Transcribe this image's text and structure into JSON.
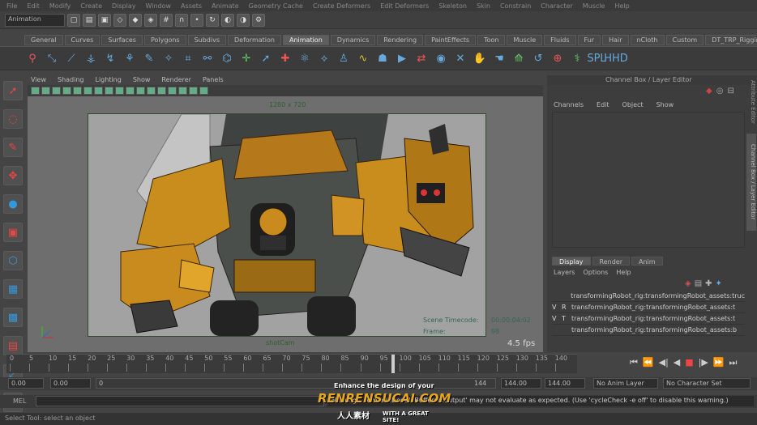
{
  "menubar": [
    "File",
    "Edit",
    "Modify",
    "Create",
    "Display",
    "Window",
    "Assets",
    "Animate",
    "Geometry Cache",
    "Create Deformers",
    "Edit Deformers",
    "Skeleton",
    "Skin",
    "Constrain",
    "Character",
    "Muscle",
    "Help"
  ],
  "statusline": {
    "mode": "Animation"
  },
  "shelf_tabs": [
    "General",
    "Curves",
    "Surfaces",
    "Polygons",
    "Subdivs",
    "Deformation",
    "Animation",
    "Dynamics",
    "Rendering",
    "PaintEffects",
    "Toon",
    "Muscle",
    "Fluids",
    "Fur",
    "Hair",
    "nCloth",
    "Custom",
    "DT_TRP_Rigging"
  ],
  "active_shelf": "Animation",
  "shelf_icon_labels": [
    "SPL",
    "HHD"
  ],
  "panel_menu": [
    "View",
    "Shading",
    "Lighting",
    "Show",
    "Renderer",
    "Panels"
  ],
  "viewport": {
    "resolution": "1280 x 720",
    "camera": "shotCam",
    "fps": "4.5 fps",
    "hud": {
      "timecode_label": "Scene Timecode:",
      "timecode_value": "00:00:04:02",
      "frame_label": "Frame:",
      "frame_value": "98"
    }
  },
  "channel_box": {
    "title": "Channel Box / Layer Editor",
    "menu": [
      "Channels",
      "Edit",
      "Object",
      "Show"
    ],
    "side_tab": "Channel Box / Layer Editor",
    "attr_tab": "Attribute Editor"
  },
  "layer_editor": {
    "tabs": [
      "Display",
      "Render",
      "Anim"
    ],
    "active": "Display",
    "menu": [
      "Layers",
      "Options",
      "Help"
    ],
    "layers": [
      {
        "v": "",
        "p": "",
        "name": "transformingRobot_rig:transformingRobot_assets:truc"
      },
      {
        "v": "V",
        "p": "R",
        "name": "transformingRobot_rig:transformingRobot_assets:t"
      },
      {
        "v": "V",
        "p": "T",
        "name": "transformingRobot_rig:transformingRobot_assets:t"
      },
      {
        "v": "",
        "p": "",
        "name": "transformingRobot_rig:transformingRobot_assets:b"
      }
    ]
  },
  "timeline": {
    "ticks": [
      "0",
      "5",
      "10",
      "15",
      "20",
      "25",
      "30",
      "35",
      "40",
      "45",
      "50",
      "55",
      "60",
      "65",
      "70",
      "75",
      "80",
      "85",
      "90",
      "95",
      "100",
      "105",
      "110",
      "115",
      "120",
      "125",
      "130",
      "135",
      "140"
    ],
    "current": "98"
  },
  "range": {
    "start": "0.00",
    "playstart": "0.00",
    "slider_start": "0",
    "slider_end": "144",
    "playend": "144.00",
    "end": "144.00",
    "anim_layer": "No Anim Layer",
    "character": "No Character Set"
  },
  "mel": {
    "label": "MEL",
    "message": "Warning: ...om.addDoubleBuffered.output' may not evaluate as expected. (Use 'cycleCheck -e off' to disable this warning.)"
  },
  "status": "Select Tool: select an object",
  "watermark": {
    "tagline": "Enhance the design of your",
    "brand": "RENRENSUCAI.COM",
    "cn": "人人素材",
    "sub": "WITH A GREAT SITE!"
  }
}
